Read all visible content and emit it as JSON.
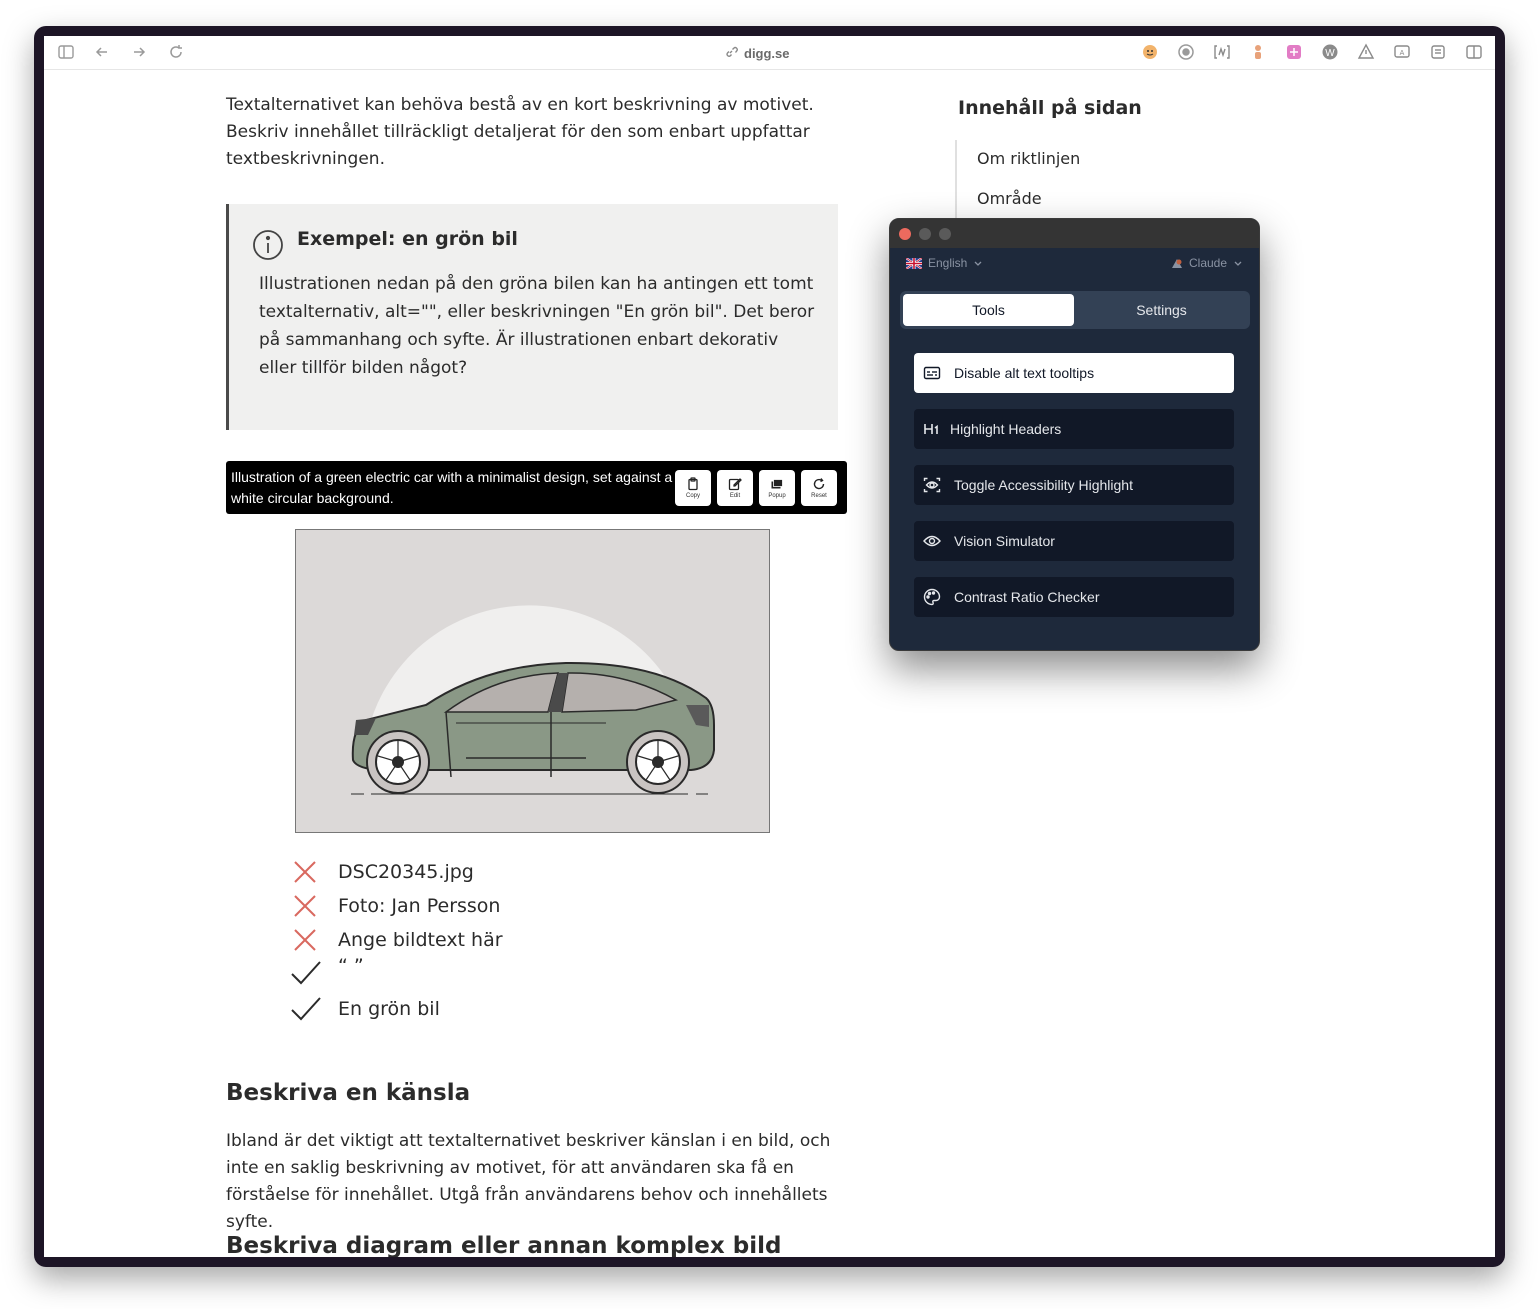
{
  "browser": {
    "url": "digg.se"
  },
  "article": {
    "intro": "Textalternativet kan behöva bestå av en kort beskrivning av motivet. Beskriv innehållet tillräckligt detaljerat för den som enbart uppfattar textbeskrivningen.",
    "callout": {
      "title": "Exempel: en grön bil",
      "body": "Illustrationen nedan på den gröna bilen kan ha antingen ett tomt textalternativ, alt=\"\", eller beskrivningen \"En grön bil\". Det beror på sammanhang och syfte. Är illustrationen enbart dekorativ eller tillför bilden något?"
    },
    "alt_tooltip": {
      "text": "Illustration of a green electric car with a minimalist design, set against a white circular background.",
      "buttons": {
        "copy": "Copy",
        "edit": "Edit",
        "popup": "Popup",
        "reset": "Reset"
      }
    },
    "checklist": [
      {
        "label": "DSC20345.jpg",
        "status": "bad"
      },
      {
        "label": "Foto: Jan Persson",
        "status": "bad"
      },
      {
        "label": "Ange bildtext här",
        "status": "bad"
      },
      {
        "label": "“ ”",
        "status": "good"
      },
      {
        "label": "En grön bil",
        "status": "good"
      }
    ],
    "section1_heading": "Beskriva en känsla",
    "section1_body": "Ibland är det viktigt att textalternativet beskriver känslan i en bild, och inte en saklig beskrivning av motivet, för att användaren ska få en förståelse för innehållet. Utgå från användarens behov och innehållets syfte.",
    "section2_heading": "Beskriva diagram eller annan komplex bild"
  },
  "toc": {
    "title": "Innehåll på sidan",
    "items": [
      "Om riktlinjen",
      "Område"
    ]
  },
  "panel": {
    "language": "English",
    "provider": "Claude",
    "tabs": {
      "tools": "Tools",
      "settings": "Settings"
    },
    "tools": [
      {
        "label": "Disable alt text tooltips",
        "icon": "caption-icon",
        "selected": true
      },
      {
        "label": "Highlight Headers",
        "icon": "h1-icon",
        "selected": false
      },
      {
        "label": "Toggle Accessibility Highlight",
        "icon": "focus-eye-icon",
        "selected": false
      },
      {
        "label": "Vision Simulator",
        "icon": "eye-icon",
        "selected": false
      },
      {
        "label": "Contrast Ratio Checker",
        "icon": "palette-icon",
        "selected": false
      }
    ]
  },
  "colors": {
    "panel_bg": "#1e293b",
    "tool_bg": "#111827",
    "bad_mark": "#d9695f",
    "good_mark": "#2b2b2b",
    "car_body": "#8a9886"
  }
}
